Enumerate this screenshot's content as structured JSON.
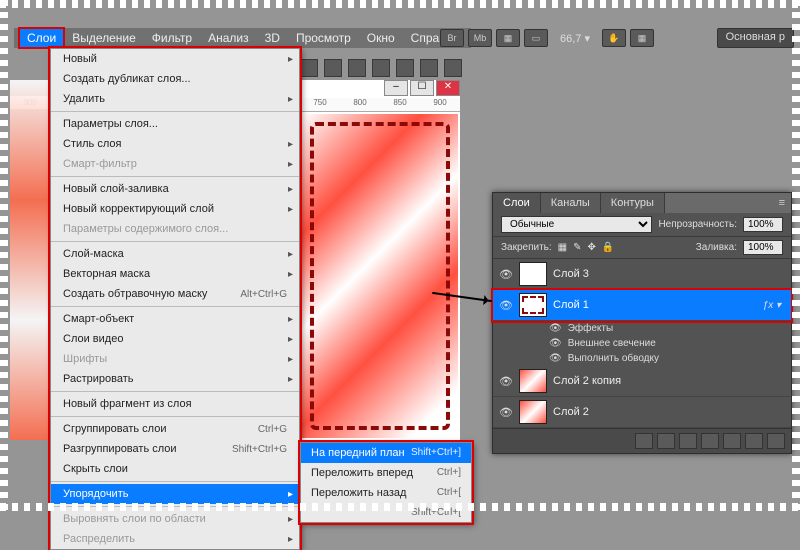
{
  "menubar": {
    "items": [
      "Слои",
      "Выделение",
      "Фильтр",
      "Анализ",
      "3D",
      "Просмотр",
      "Окно",
      "Справка"
    ],
    "active_index": 0
  },
  "zoom": "66,7",
  "main_button": "Основная р",
  "left_ruler": "300",
  "canvas_ruler": [
    "750",
    "800",
    "850",
    "900"
  ],
  "dropdown": [
    {
      "label": "Новый",
      "type": "arrow"
    },
    {
      "label": "Создать дубликат слоя..."
    },
    {
      "label": "Удалить",
      "type": "arrow"
    },
    {
      "type": "sep"
    },
    {
      "label": "Параметры слоя..."
    },
    {
      "label": "Стиль слоя",
      "type": "arrow"
    },
    {
      "label": "Смарт-фильтр",
      "type": "arrow",
      "disabled": true
    },
    {
      "type": "sep"
    },
    {
      "label": "Новый слой-заливка",
      "type": "arrow"
    },
    {
      "label": "Новый корректирующий слой",
      "type": "arrow"
    },
    {
      "label": "Параметры содержимого слоя...",
      "disabled": true
    },
    {
      "type": "sep"
    },
    {
      "label": "Слой-маска",
      "type": "arrow"
    },
    {
      "label": "Векторная маска",
      "type": "arrow"
    },
    {
      "label": "Создать обтравочную маску",
      "shortcut": "Alt+Ctrl+G"
    },
    {
      "type": "sep"
    },
    {
      "label": "Смарт-объект",
      "type": "arrow"
    },
    {
      "label": "Слои видео",
      "type": "arrow"
    },
    {
      "label": "Шрифты",
      "type": "arrow",
      "disabled": true
    },
    {
      "label": "Растрировать",
      "type": "arrow"
    },
    {
      "type": "sep"
    },
    {
      "label": "Новый фрагмент из слоя"
    },
    {
      "type": "sep"
    },
    {
      "label": "Сгруппировать слои",
      "shortcut": "Ctrl+G"
    },
    {
      "label": "Разгруппировать слои",
      "shortcut": "Shift+Ctrl+G"
    },
    {
      "label": "Скрыть слои"
    },
    {
      "type": "sep"
    },
    {
      "label": "Упорядочить",
      "type": "arrow",
      "hl": true
    },
    {
      "type": "sep"
    },
    {
      "label": "Выровнять слои по области",
      "type": "arrow",
      "disabled": true
    },
    {
      "label": "Распределить",
      "type": "arrow",
      "disabled": true
    }
  ],
  "submenu": [
    {
      "label": "На передний план",
      "shortcut": "Shift+Ctrl+]",
      "hl": true
    },
    {
      "label": "Переложить вперед",
      "shortcut": "Ctrl+]"
    },
    {
      "label": "Переложить назад",
      "shortcut": "Ctrl+["
    },
    {
      "label": "",
      "shortcut": "Shift+Ctrl+[",
      "disabled": true
    }
  ],
  "panel": {
    "tabs": [
      "Слои",
      "Каналы",
      "Контуры"
    ],
    "active_tab": 0,
    "blend": "Обычные",
    "opacity_label": "Непрозрачность:",
    "opacity": "100%",
    "lock_label": "Закрепить:",
    "fill_label": "Заливка:",
    "fill": "100%",
    "layers": [
      {
        "name": "Слой 3",
        "thumb": "plain"
      },
      {
        "name": "Слой 1",
        "thumb": "outline",
        "selected": true,
        "fx": "ƒx"
      },
      {
        "name": "Слой 2 копия",
        "thumb": "red"
      },
      {
        "name": "Слой 2",
        "thumb": "red"
      }
    ],
    "effects_header": "Эффекты",
    "effects": [
      "Внешнее свечение",
      "Выполнить обводку"
    ]
  }
}
